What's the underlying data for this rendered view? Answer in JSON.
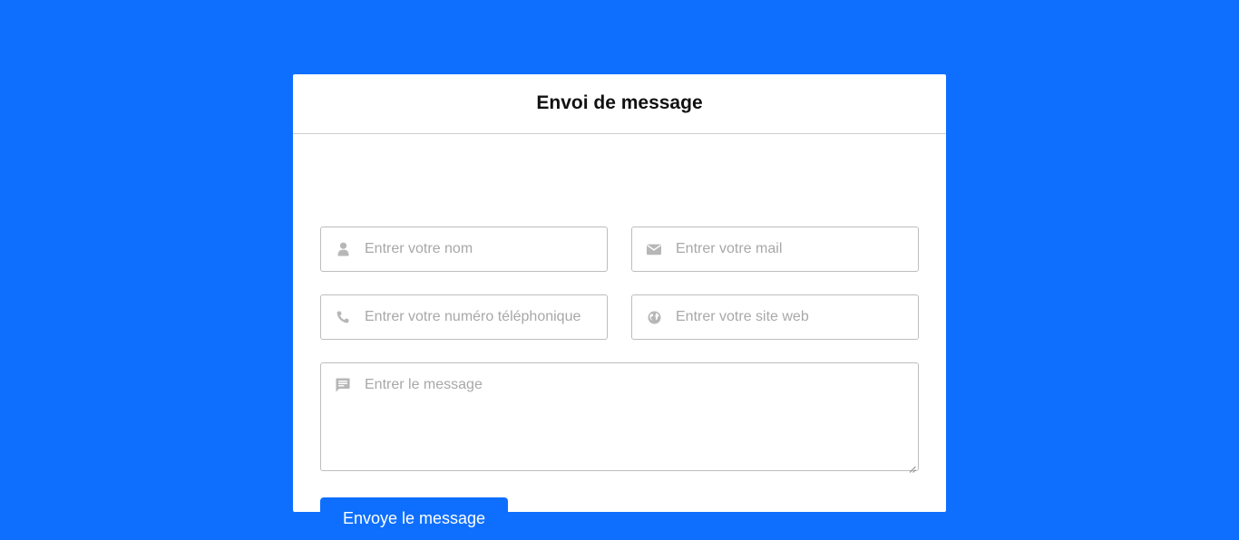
{
  "colors": {
    "background": "#0e6ffe",
    "card": "#ffffff",
    "button": "#0e6ffe",
    "icon": "#b7b7b7"
  },
  "form": {
    "title": "Envoi de message",
    "fields": {
      "name": {
        "placeholder": "Entrer votre nom",
        "value": "",
        "icon": "user-icon"
      },
      "mail": {
        "placeholder": "Entrer votre mail",
        "value": "",
        "icon": "envelope-icon"
      },
      "phone": {
        "placeholder": "Entrer votre numéro téléphonique",
        "value": "",
        "icon": "phone-icon"
      },
      "website": {
        "placeholder": "Entrer votre site web",
        "value": "",
        "icon": "globe-icon"
      },
      "message": {
        "placeholder": "Entrer le message",
        "value": "",
        "icon": "message-icon"
      }
    },
    "submit_label": "Envoye le message"
  }
}
